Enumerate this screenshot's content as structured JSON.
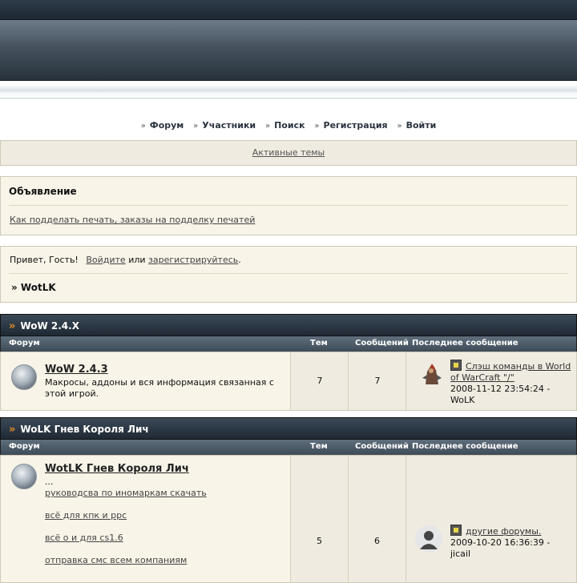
{
  "nav": {
    "items": [
      "Форум",
      "Участники",
      "Поиск",
      "Регистрация",
      "Войти"
    ]
  },
  "active_topics": "Активные темы",
  "announcement": {
    "title": "Объявление",
    "link": "Как подделать печать, заказы на подделку печатей"
  },
  "greeting": {
    "prefix": "Привет, Гость!",
    "login": "Войдите",
    "or": "или",
    "register": "зарегистрируйтесь",
    "suffix": ".",
    "breadcrumb": "» WotLK"
  },
  "columns": {
    "forum": "Форум",
    "topics": "Тем",
    "posts": "Сообщений",
    "last": "Последнее сообщение"
  },
  "categories": [
    {
      "title": "WoW 2.4.X",
      "forum": {
        "name": "WoW 2.4.3",
        "desc": "Макросы, аддоны и вся информация связанная с этой игрой.",
        "topics": "7",
        "posts": "7",
        "last": {
          "title": "Слэш команды в World of WarCraft \"/\"",
          "date": "2008-11-12 23:54:24 -",
          "user": "WoLK"
        }
      }
    },
    {
      "title": "WoLK Гнев Короля Лич",
      "forum": {
        "name": "WotLK Гнев Короля Лич",
        "desc": "...",
        "subforums": [
          "руководсва по иномаркам скачать",
          "всё для кпк и ppc",
          "всё о и для cs1.6",
          "отправка смс всем компаниям"
        ],
        "topics": "5",
        "posts": "6",
        "last": {
          "title": "другие форумы.",
          "date": "2009-10-20 16:36:39 -",
          "user": "jicail"
        }
      }
    }
  ]
}
